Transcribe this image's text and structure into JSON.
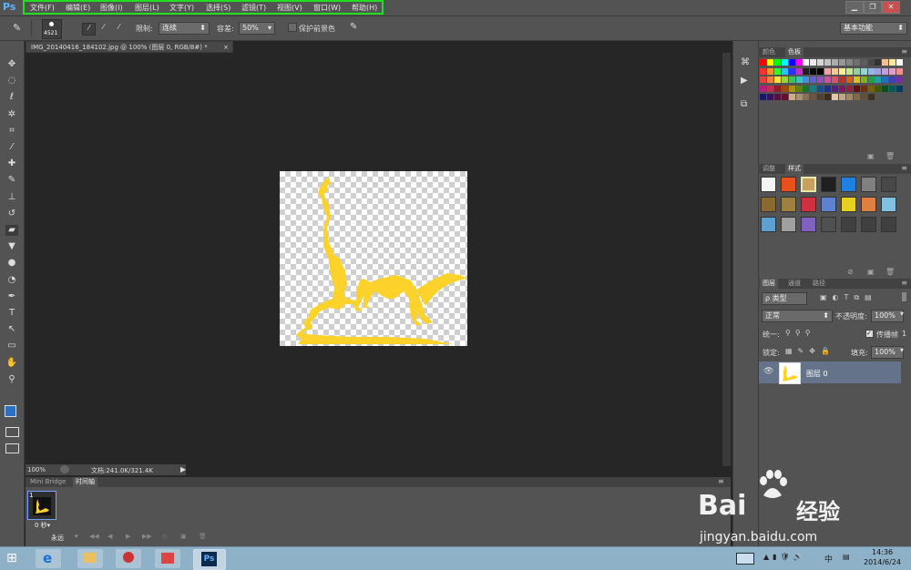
{
  "menubar": {
    "logo": "Ps",
    "items": [
      "文件(F)",
      "编辑(E)",
      "图像(I)",
      "图层(L)",
      "文字(Y)",
      "选择(S)",
      "滤镜(T)",
      "视图(V)",
      "窗口(W)",
      "帮助(H)"
    ],
    "highlight_color": "#22dd22"
  },
  "optbar": {
    "brush_size": "4521",
    "limit_label": "限制:",
    "limit_value": "连续",
    "tolerance_label": "容差:",
    "tolerance_value": "50%",
    "protect_fg_label": "保护前景色",
    "workspace": "基本功能"
  },
  "doc": {
    "tab_title": "IMG_20140416_184102.jpg @ 100% (图层 0, RGB/8#) *",
    "zoom": "100%",
    "doc_info": "文档:241.0K/321.4K"
  },
  "bottom_panel": {
    "tabs": [
      "Mini Bridge",
      "时间轴"
    ],
    "frame_number": "1",
    "frame_delay": "0 秒▾",
    "loop": "永远"
  },
  "swatches_panel": {
    "tabs": [
      "颜色",
      "色板"
    ]
  },
  "styles_panel": {
    "tabs": [
      "调整",
      "样式"
    ]
  },
  "layers_panel": {
    "tabs": [
      "图层",
      "通道",
      "路径"
    ],
    "filter_kind": "ρ 类型",
    "blend_mode": "正常",
    "opacity_label": "不透明度:",
    "opacity_value": "100%",
    "unify_label": "统一:",
    "propagate_label": "传播帧",
    "propagate_value": "1",
    "lock_label": "锁定:",
    "fill_label": "填充:",
    "fill_value": "100%",
    "layer_name": "图层 0"
  },
  "taskbar": {
    "time": "14:36",
    "date": "2014/6/24",
    "ime": "中"
  },
  "watermark": {
    "brand": "Bai",
    "brand_cn": "经验",
    "url": "jingyan.baidu.com"
  },
  "colors": {
    "wolf": "#fcd22b",
    "canvas_bg": "#262626",
    "panel": "#535353",
    "accent_blue": "#2a6fc0"
  }
}
